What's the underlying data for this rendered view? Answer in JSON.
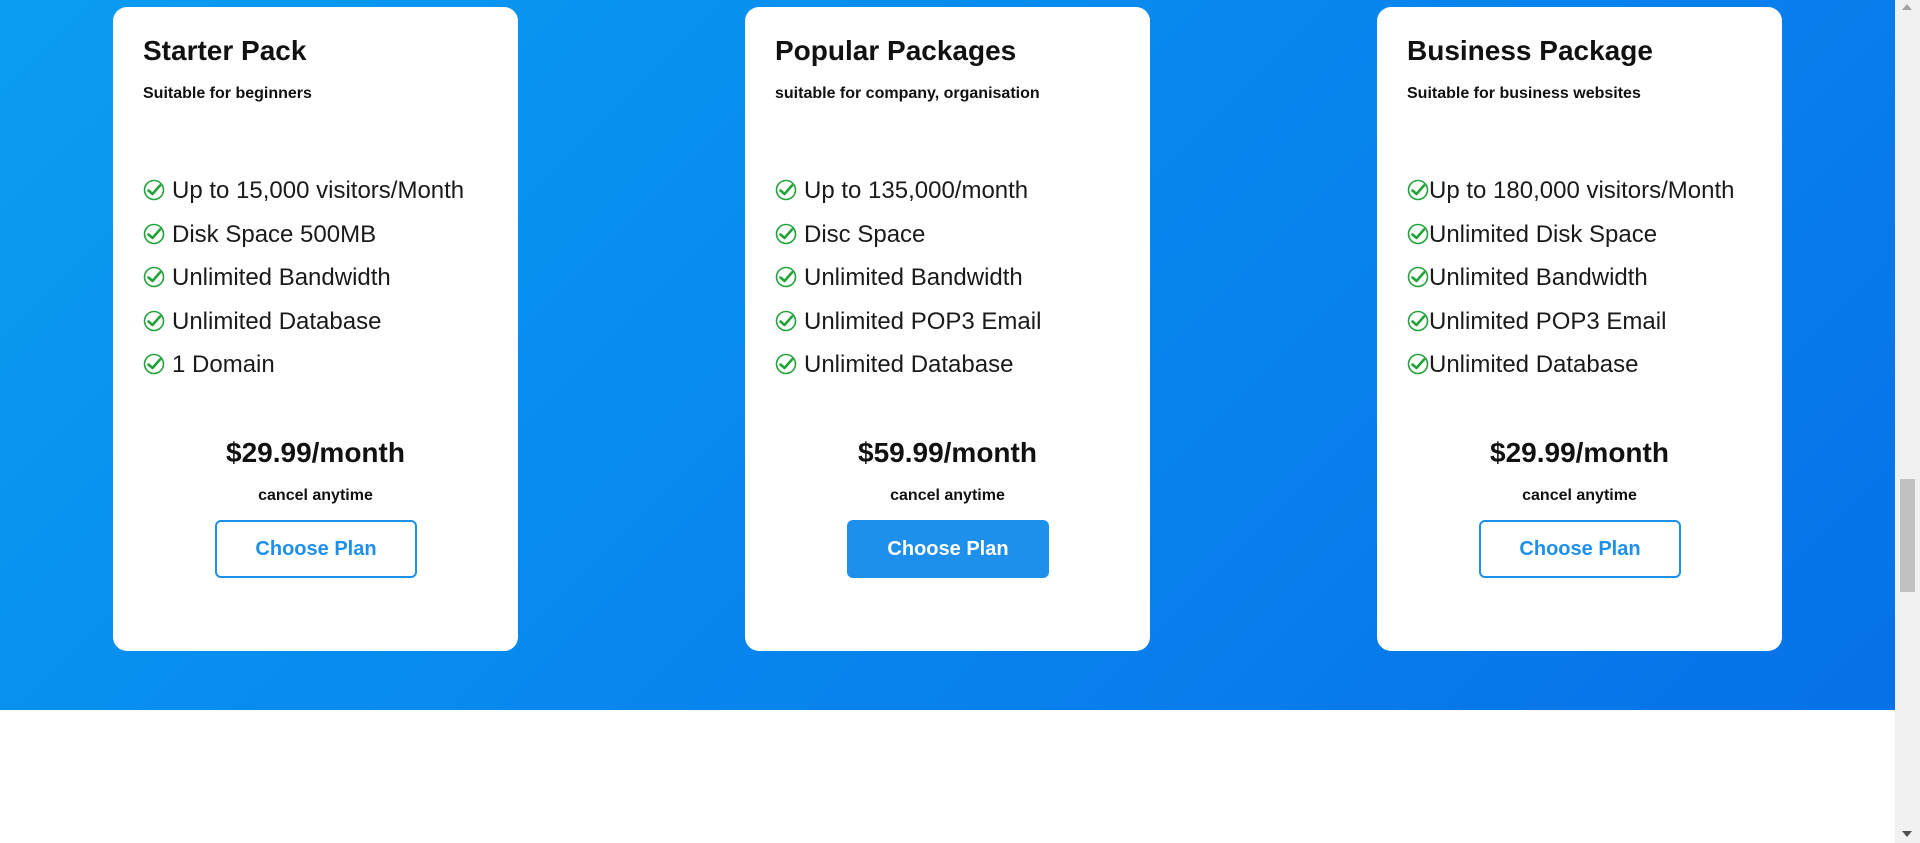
{
  "plans": [
    {
      "title": "Starter Pack",
      "subtitle": "Suitable for beginners",
      "features": [
        "Up to 15,000 visitors/Month",
        "Disk Space 500MB",
        "Unlimited Bandwidth",
        "Unlimited Database",
        "1 Domain"
      ],
      "price": "$29.99/month",
      "cancel_note": "cancel anytime",
      "button_label": "Choose Plan"
    },
    {
      "title": "Popular Packages",
      "subtitle": "suitable for company, organisation",
      "features": [
        "Up to 135,000/month",
        "Disc Space",
        "Unlimited Bandwidth",
        "Unlimited POP3 Email",
        "Unlimited Database"
      ],
      "price": "$59.99/month",
      "cancel_note": "cancel anytime",
      "button_label": "Choose Plan"
    },
    {
      "title": "Business Package",
      "subtitle": "Suitable for business websites",
      "features": [
        "Up to 180,000 visitors/Month",
        "Unlimited Disk Space",
        "Unlimited Bandwidth",
        "Unlimited POP3 Email",
        "Unlimited Database"
      ],
      "price": "$29.99/month",
      "cancel_note": "cancel anytime",
      "button_label": "Choose Plan"
    }
  ],
  "colors": {
    "accent": "#1e90ec",
    "check": "#22a33a",
    "gradient_start": "#0a9df1",
    "gradient_end": "#0771e8"
  },
  "icons": {
    "feature_check": "check-circle-icon"
  }
}
